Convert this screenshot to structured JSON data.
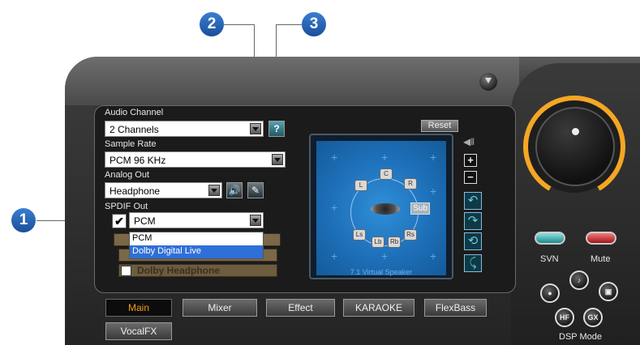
{
  "callouts": [
    "1",
    "2",
    "3"
  ],
  "audio_channel": {
    "label": "Audio Channel",
    "value": "2 Channels",
    "help": "?"
  },
  "sample_rate": {
    "label": "Sample Rate",
    "value": "PCM 96 KHz"
  },
  "analog_out": {
    "label": "Analog Out",
    "value": "Headphone"
  },
  "spdif_out": {
    "label": "SPDIF Out",
    "checked": "✔",
    "value": "PCM",
    "options": [
      "PCM",
      "Dolby Digital Live"
    ],
    "selected_option": "Dolby Digital Live"
  },
  "dolby_headphone": "Dolby Headphone",
  "speaker": {
    "reset": "Reset",
    "labels": {
      "c": "C",
      "l": "L",
      "r": "R",
      "sub": "Sub",
      "ls": "Ls",
      "lb": "Lb",
      "rb": "Rb",
      "rs": "Rs"
    },
    "caption": "7.1 Virtual Speaker",
    "zoom_in": "+",
    "zoom_out": "−"
  },
  "tabs": [
    "Main",
    "Mixer",
    "Effect",
    "KARAOKE",
    "FlexBass",
    "VocalFX"
  ],
  "active_tab": "Main",
  "svn_label": "SVN",
  "mute_label": "Mute",
  "dsp": {
    "label": "DSP Mode",
    "hf": "HF",
    "gx": "GX"
  },
  "colors": {
    "accent": "#f39a1c",
    "selection": "#2f6fd8",
    "callout": "#1a4e9a"
  }
}
